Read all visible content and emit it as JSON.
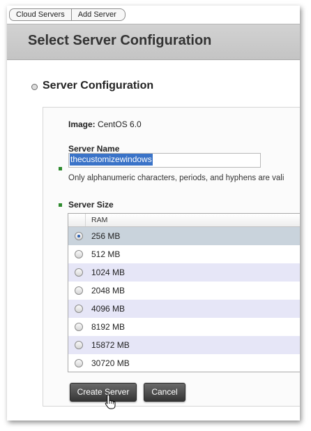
{
  "breadcrumb": [
    "Cloud Servers",
    "Add Server"
  ],
  "page": {
    "title": "Select Server Configuration"
  },
  "section": {
    "title": "Server Configuration"
  },
  "image": {
    "label": "Image:",
    "value": "CentOS 6.0"
  },
  "server_name": {
    "label": "Server Name",
    "value": "thecustomizewindows",
    "hint": "Only alphanumeric characters, periods, and hyphens are vali"
  },
  "server_size": {
    "label": "Server Size",
    "column_header": "RAM",
    "options": [
      "256 MB",
      "512 MB",
      "1024 MB",
      "2048 MB",
      "4096 MB",
      "8192 MB",
      "15872 MB",
      "30720 MB"
    ],
    "selected": "256 MB"
  },
  "buttons": {
    "create": "Create Server",
    "cancel": "Cancel"
  },
  "colors": {
    "required_marker": "#2d8a2d",
    "selected_row": "#c9d3dc",
    "alt_row": "#e6e6f7"
  }
}
